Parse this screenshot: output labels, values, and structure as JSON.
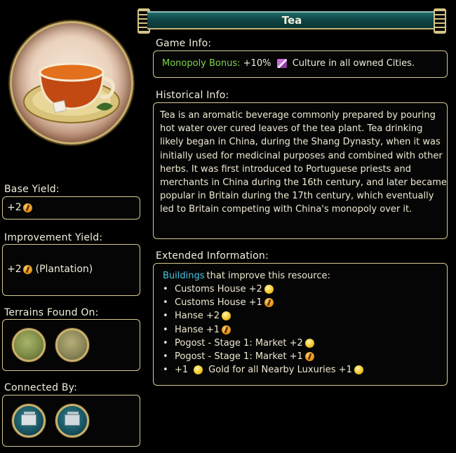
{
  "title": "Tea",
  "game_info": {
    "heading": "Game Info:",
    "label": "Monopoly Bonus:",
    "text_before_icon": "+10%",
    "text_after_icon": "Culture in all owned Cities."
  },
  "historical_info": {
    "heading": "Historical Info:",
    "text": "Tea is an aromatic beverage commonly prepared by pouring hot water over cured leaves of the tea plant. Tea drinking likely began in China, during the Shang Dynasty, when it was initially used for medicinal purposes and combined with other herbs. It was first introduced to Portuguese priests and merchants in China during the 16th century, and later became popular in Britain during the 17th century, which eventually led to Britain competing with China's monopoly over it."
  },
  "base_yield": {
    "heading": "Base Yield:",
    "value": "+2",
    "icon": "production-icon"
  },
  "improvement_yield": {
    "heading": "Improvement Yield:",
    "value": "+2",
    "note": "(Plantation)",
    "icon": "production-icon"
  },
  "terrains": {
    "heading": "Terrains Found On:",
    "items": [
      "grassland-terrain-icon",
      "plains-terrain-icon"
    ]
  },
  "connected_by": {
    "heading": "Connected By:",
    "items": [
      "plantation-improvement-icon",
      "trade-improvement-icon"
    ]
  },
  "extended": {
    "heading": "Extended Information:",
    "intro_link": "Buildings",
    "intro_rest": "that improve this resource:",
    "items": [
      {
        "text": "Customs House +2",
        "icon": "gold"
      },
      {
        "text": "Customs House +1",
        "icon": "prod"
      },
      {
        "text": "Hanse +2",
        "icon": "gold"
      },
      {
        "text": "Hanse +1",
        "icon": "prod"
      },
      {
        "text": "Pogost - Stage 1: Market +2",
        "icon": "gold"
      },
      {
        "text": "Pogost - Stage 1: Market +1",
        "icon": "prod"
      }
    ],
    "last_pre": "+1",
    "last_mid": "Gold for all Nearby Luxuries +1",
    "bullet": "•"
  },
  "colors": {
    "accent_green": "#7dd24a",
    "link_cyan": "#47c6e6",
    "border_gold": "#d9cc95",
    "banner_teal": "#0e4645"
  }
}
